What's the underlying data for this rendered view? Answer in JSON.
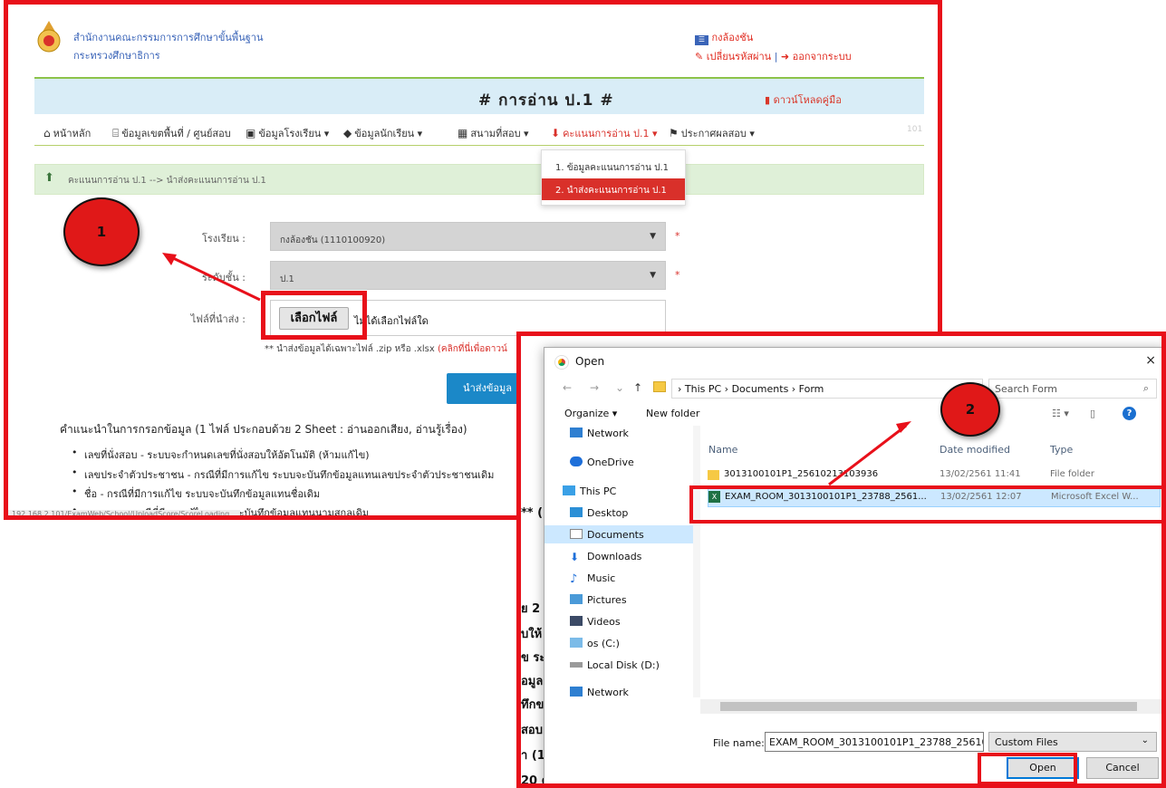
{
  "header": {
    "org_line1": "สำนักงานคณะกรรมการการศึกษาขั้นพื้นฐาน",
    "org_line2": "กระทรวงศึกษาธิการ",
    "user_name": "กงล้องชัน",
    "change_password": "เปลี่ยนรหัสผ่าน",
    "separator": "|",
    "logout": "ออกจากระบบ"
  },
  "banner": {
    "title": "# การอ่าน ป.1 #",
    "download_manual": "ดาวน์โหลดคู่มือ"
  },
  "nav": {
    "items": [
      "หน้าหลัก",
      "ข้อมูลเขตพื้นที่ / ศูนย์สอบ",
      "ข้อมูลโรงเรียน ▾",
      "ข้อมูลนักเรียน ▾",
      "สนามที่สอบ ▾",
      "คะแนนการอ่าน ป.1 ▾",
      "ประกาศผลสอบ ▾"
    ],
    "right_code": "101"
  },
  "dropdown": {
    "items": [
      "1. ข้อมูลคะแนนการอ่าน ป.1",
      "2. นำส่งคะแนนการอ่าน ป.1"
    ]
  },
  "alert": {
    "text": "คะแนนการอ่าน ป.1 --> นำส่งคะแนนการอ่าน ป.1"
  },
  "form": {
    "school_label": "โรงเรียน :",
    "school_value": "กงล้องชัน (1110100920)",
    "level_label": "ระดับชั้น :",
    "level_value": "ป.1",
    "file_label": "ไฟล์ที่นำส่ง :",
    "file_button": "เลือกไฟล์",
    "file_status": "ไม่ได้เลือกไฟล์ใด",
    "note": "** นำส่งข้อมูลได้เฉพาะไฟล์ .zip หรือ .xlsx",
    "note_link": "(คลิกที่นี่เพื่อดาวน์",
    "submit": "นำส่งข้อมูล",
    "required_mark": "*"
  },
  "instructions": {
    "heading": "คำแนะนำในการกรอกข้อมูล (1 ไฟล์ ประกอบด้วย 2 Sheet : อ่านออกเสียง, อ่านรู้เรื่อง)",
    "bullets": [
      "เลขที่นั่งสอบ - ระบบจะกำหนดเลขที่นั่งสอบให้อัตโนมัติ (ห้ามแก้ไข)",
      "เลขประจำตัวประชาชน - กรณีที่มีการแก้ไข ระบบจะบันทึกข้อมูลแทนเลขประจำตัวประชาชนเดิม",
      "ชื่อ - กรณีที่มีการแก้ไข ระบบจะบันทึกข้อมูลแทนชื่อเดิม",
      "นามสกุล - กรณีที่มีการแก้ไข ระบบจะบันทึกข้อมูลแทนนามสกุลเดิม"
    ]
  },
  "status_url": "192.168.2.101/ExamWeb/School/UploadScore/ScoreLoading...",
  "callouts": {
    "one": "1",
    "two": "2"
  },
  "background_fragments": [
    "ย 2",
    "บให้",
    "ข ระ",
    "อมูลแ",
    "ทึกข",
    "สอบ\"",
    "า (1(",
    "20 ค",
    "** ("
  ],
  "dialog": {
    "title": "Open",
    "close": "×",
    "breadcrumb": "›  This PC  ›  Documents  ›  Form",
    "search_placeholder": "Search Form",
    "organize": "Organize ▾",
    "new_folder": "New folder",
    "sidebar": [
      "Network",
      "OneDrive",
      "This PC",
      "Desktop",
      "Documents",
      "Downloads",
      "Music",
      "Pictures",
      "Videos",
      "os (C:)",
      "Local Disk (D:)",
      "Network"
    ],
    "columns": {
      "name": "Name",
      "date": "Date modified",
      "type": "Type"
    },
    "files": [
      {
        "name": "3013100101P1_25610213103936",
        "date": "13/02/2561 11:41",
        "type": "File folder"
      },
      {
        "name": "EXAM_ROOM_3013100101P1_23788_2561...",
        "date": "13/02/2561 12:07",
        "type": "Microsoft Excel W..."
      }
    ],
    "file_name_label": "File name:",
    "file_name_value": "EXAM_ROOM_3013100101P1_23788_25610213",
    "file_type": "Custom Files",
    "open": "Open",
    "cancel": "Cancel"
  }
}
